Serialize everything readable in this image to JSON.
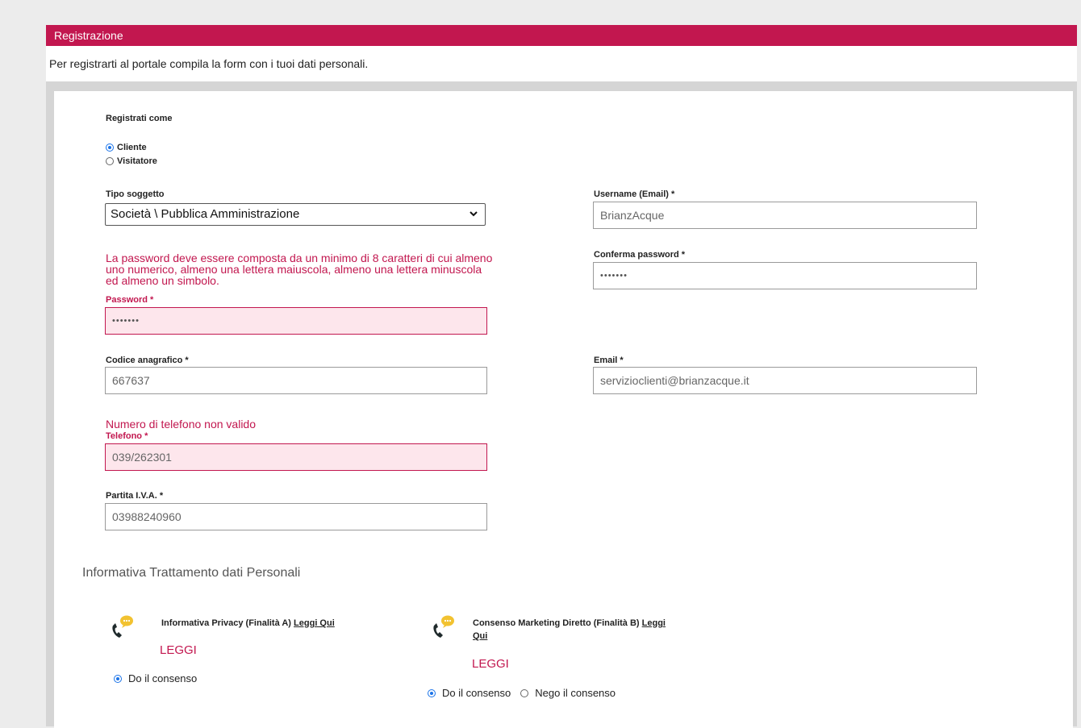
{
  "header": {
    "title": "Registrazione"
  },
  "intro": {
    "text": "Per registrarti al portale compila la form con i tuoi dati personali."
  },
  "register_as": {
    "label": "Registrati come",
    "options": [
      {
        "label": "Cliente",
        "selected": true
      },
      {
        "label": "Visitatore",
        "selected": false
      }
    ]
  },
  "tipo_soggetto": {
    "label": "Tipo soggetto",
    "value": "Società \\ Pubblica Amministrazione"
  },
  "username": {
    "label": "Username (Email) *",
    "value": "BrianzAcque"
  },
  "password_hint": "La password deve essere composta da un minimo di 8 caratteri di cui almeno uno numerico, almeno una lettera maiuscola, almeno una lettera minuscola ed almeno un simbolo.",
  "password": {
    "label": "Password *",
    "value": "•••••••"
  },
  "confirm_password": {
    "label": "Conferma password *",
    "value": "•••••••"
  },
  "codice_anagrafico": {
    "label": "Codice anagrafico *",
    "value": "667637"
  },
  "email": {
    "label": "Email *",
    "value": "servizioclienti@brianzacque.it"
  },
  "phone_error": "Numero di telefono non valido",
  "telefono": {
    "label": "Telefono *",
    "value": "039/262301"
  },
  "partita_iva": {
    "label": "Partita I.V.A. *",
    "value": "03988240960"
  },
  "privacy_section": {
    "title": "Informativa Trattamento dati Personali",
    "privacy": {
      "text": "Informativa Privacy (Finalità A)",
      "link": "Leggi Qui",
      "leggi": "LEGGI",
      "options": [
        {
          "label": "Do il consenso",
          "selected": true
        }
      ]
    },
    "marketing": {
      "text": "Consenso Marketing Diretto (Finalità B)",
      "link_part1": "Leggi",
      "link_part2": "Qui",
      "leggi": "LEGGI",
      "options": [
        {
          "label": "Do il consenso",
          "selected": true
        },
        {
          "label": "Nego il consenso",
          "selected": false
        }
      ]
    }
  },
  "colors": {
    "accent": "#c2174f",
    "radio": "#1a73e8",
    "icon_yellow": "#f2c230",
    "icon_phone": "#1f2a2c"
  }
}
